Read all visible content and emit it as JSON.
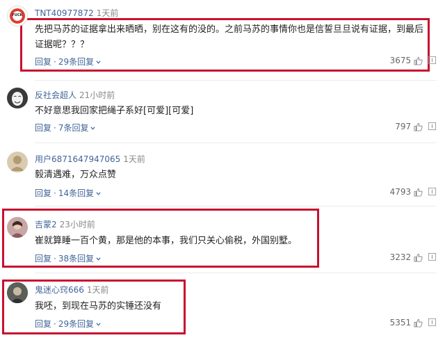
{
  "comments": [
    {
      "username": "TNT40977872",
      "time": "1天前",
      "content": "先把马苏的证据拿出来晒晒，别在这有的没的。之前马苏的事情你也是信誓旦旦说有证据，到最后证据呢？？？",
      "reply_label": "回复",
      "dot": "·",
      "replies_label": "29条回复",
      "likes": "3675",
      "avatar_badge": "FUCK",
      "highlighted": true
    },
    {
      "username": "反社会超人",
      "time": "21小时前",
      "content": "不好意思我回家把绳子系好[可爱][可爱]",
      "reply_label": "回复",
      "dot": "·",
      "replies_label": "7条回复",
      "likes": "797",
      "highlighted": false
    },
    {
      "username": "用户6871647947065",
      "time": "1天前",
      "content": "毅清遇难，万众点赞",
      "reply_label": "回复",
      "dot": "·",
      "replies_label": "14条回复",
      "likes": "4793",
      "highlighted": false
    },
    {
      "username": "吉蒙2",
      "time": "23小时前",
      "content": "崔就算睡一百个黄，那是他的本事，我们只关心偷税，外国别墅。",
      "reply_label": "回复",
      "dot": "·",
      "replies_label": "38条回复",
      "likes": "3232",
      "highlighted": true
    },
    {
      "username": "鬼迷心窍666",
      "time": "1天前",
      "content": "我呸，到现在马苏的实锤还没有",
      "reply_label": "回复",
      "dot": "·",
      "replies_label": "29条回复",
      "likes": "5351",
      "highlighted": true
    }
  ],
  "colors": {
    "link": "#406599",
    "highlight_border": "#c8102e",
    "muted": "#888888"
  }
}
